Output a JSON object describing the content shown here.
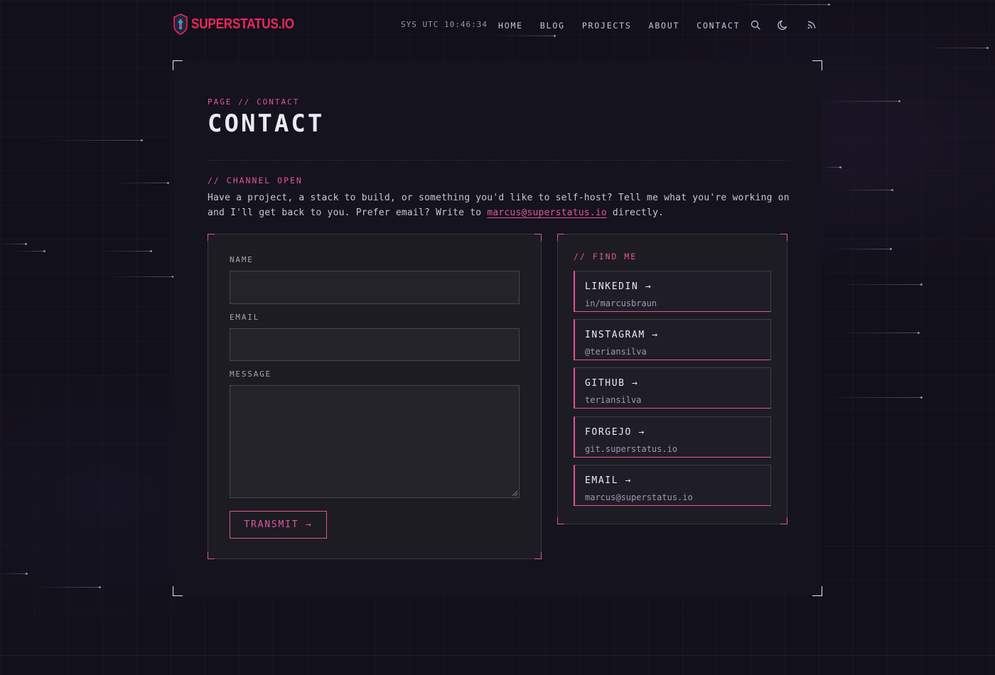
{
  "header": {
    "logo_text": "SUPERSTATUS.IO",
    "sys_time": "SYS UTC 10:46:34",
    "nav": [
      "HOME",
      "BLOG",
      "PROJECTS",
      "ABOUT",
      "CONTACT"
    ],
    "icons": [
      "search-icon",
      "moon-icon",
      "rss-icon"
    ]
  },
  "page": {
    "eyebrow": "PAGE // CONTACT",
    "title": "CONTACT",
    "section_label": "// CHANNEL OPEN",
    "intro_line1": "Have a project, a stack to build, or something you'd like to self-host? Tell me what you're working on",
    "intro_line2_before": "and I'll get back to you. Prefer email? Write to ",
    "intro_email": "marcus@superstatus.io",
    "intro_line2_after": " directly."
  },
  "form": {
    "name_label": "NAME",
    "name_value": "",
    "email_label": "EMAIL",
    "email_value": "",
    "message_label": "MESSAGE",
    "message_value": "",
    "submit_label": "TRANSMIT →"
  },
  "find_me": {
    "title": "// FIND ME",
    "links": [
      {
        "title": "LINKEDIN →",
        "sub": "in/marcusbraun"
      },
      {
        "title": "INSTAGRAM →",
        "sub": "@teriansilva"
      },
      {
        "title": "GITHUB →",
        "sub": "teriansilva"
      },
      {
        "title": "FORGEJO →",
        "sub": "git.superstatus.io"
      },
      {
        "title": "EMAIL →",
        "sub": "marcus@superstatus.io"
      }
    ]
  },
  "colors": {
    "accent": "#e0559a",
    "logo": "#e8285f",
    "background": "#12101a",
    "panel": "#16141e"
  }
}
